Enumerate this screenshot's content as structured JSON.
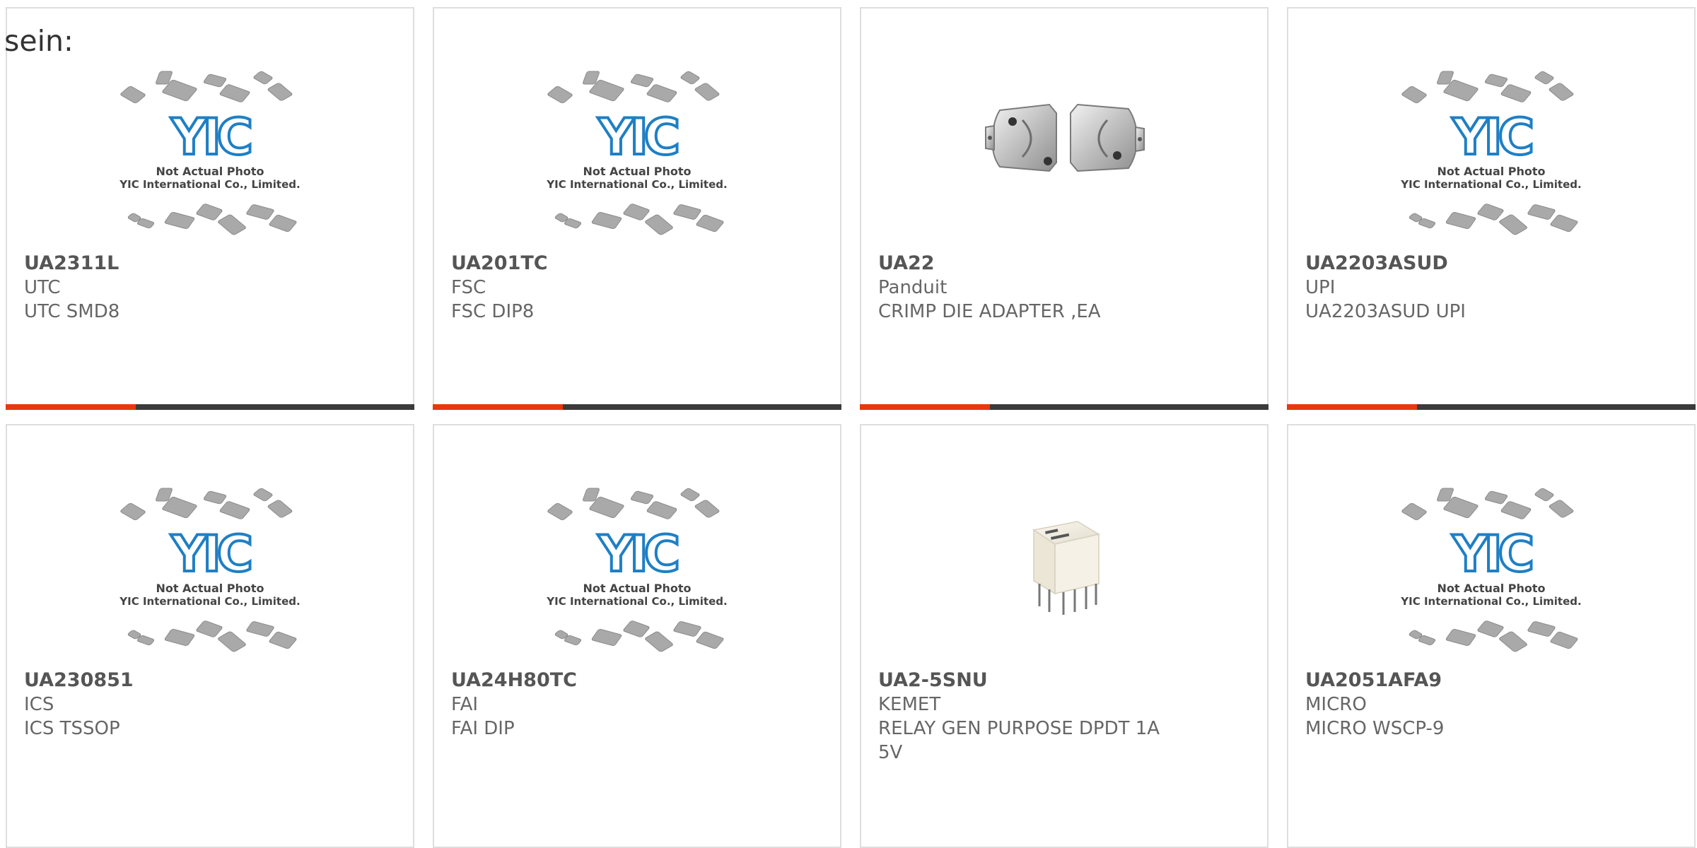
{
  "page": {
    "lead_text": "sein:"
  },
  "placeholder_image": {
    "logo_text": "YIC",
    "caption_line1": "Not Actual Photo",
    "caption_line2": "YIC International Co., Limited."
  },
  "colors": {
    "accent": "#e8380d",
    "bar_dark": "#3b3b3b",
    "logo_blue": "#1f7fc4",
    "chip_gray": "#a9a9a9"
  },
  "products": [
    {
      "part_number": "UA2311L",
      "manufacturer": "UTC",
      "description": "UTC SMD8",
      "image": "placeholder"
    },
    {
      "part_number": "UA201TC",
      "manufacturer": "FSC",
      "description": "FSC DIP8",
      "image": "placeholder"
    },
    {
      "part_number": "UA22",
      "manufacturer": "Panduit",
      "description": "CRIMP DIE ADAPTER ,EA",
      "image": "crimp-die-adapter-photo"
    },
    {
      "part_number": "UA2203ASUD",
      "manufacturer": "UPI",
      "description": "UA2203ASUD UPI",
      "image": "placeholder"
    },
    {
      "part_number": "UA230851",
      "manufacturer": "ICS",
      "description": "ICS TSSOP",
      "image": "placeholder"
    },
    {
      "part_number": "UA24H80TC",
      "manufacturer": "FAI",
      "description": "FAI DIP",
      "image": "placeholder"
    },
    {
      "part_number": "UA2-5SNU",
      "manufacturer": "KEMET",
      "description": "RELAY GEN PURPOSE DPDT 1A 5V",
      "image": "relay-photo"
    },
    {
      "part_number": "UA2051AFA9",
      "manufacturer": "MICRO",
      "description": "MICRO WSCP-9",
      "image": "placeholder"
    }
  ]
}
